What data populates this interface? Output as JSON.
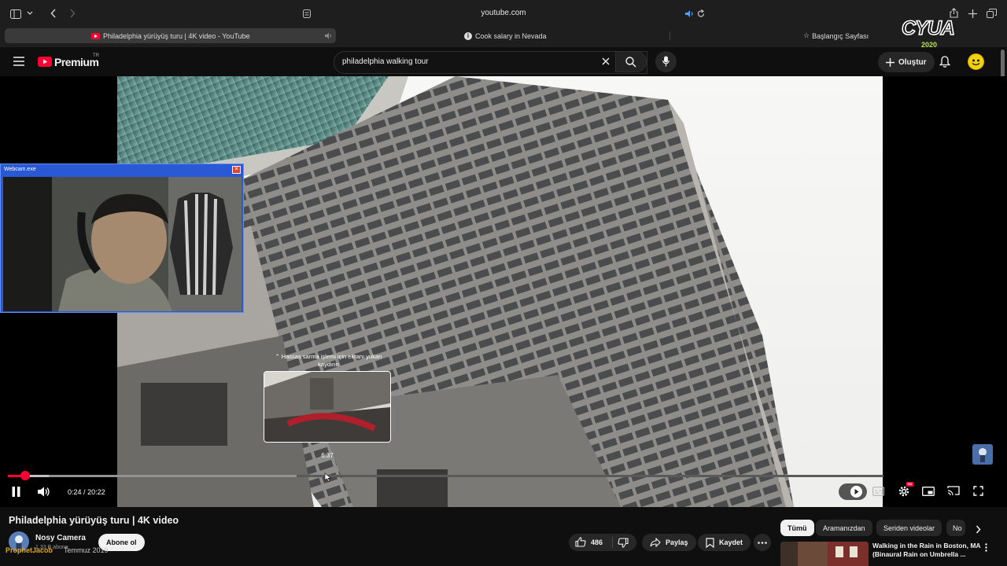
{
  "browser": {
    "url": "youtube.com",
    "tabs": [
      {
        "label": "Philadelphia yürüyüş turu | 4K video - YouTube",
        "active": true
      },
      {
        "label": "Cook salary in Nevada",
        "active": false
      },
      {
        "label": "Başlangıç Sayfası",
        "active": false
      }
    ]
  },
  "overlay_logo": {
    "text": "CYUA",
    "year": "2020"
  },
  "header": {
    "brand": "Premium",
    "region": "TR",
    "search_value": "philadelphia walking tour",
    "create_label": "Oluştur"
  },
  "webcam": {
    "title": "Webcam.exe"
  },
  "player": {
    "seek_hint": "Hassas sarma işlemi için ekranı yukarı kaydırın",
    "preview_time": "6:37",
    "current_time": "0:24",
    "duration": "20:22",
    "time_separator": "/",
    "played_fraction": 0.02,
    "buffered_fraction": 0.047,
    "hover_fraction": 0.33
  },
  "video": {
    "title": "Philadelphia yürüyüş turu | 4K video",
    "channel": "Nosy Camera",
    "subscribers": "1,33 B abone",
    "subscribe_label": "Abone ol",
    "date": "Temmuz 2019",
    "watermark": "ProphetJacob",
    "likes": "486",
    "share_label": "Paylaş",
    "save_label": "Kaydet"
  },
  "chips": [
    "Tümü",
    "Aramanızdan",
    "Seriden videolar",
    "No"
  ],
  "recommendation": {
    "title": "Walking in the Rain in Boston, MA (Binaural Rain on Umbrella ..."
  },
  "colors": {
    "accent_red": "#ff0033",
    "avatar_yellow": "#f2d20c",
    "webcam_frame": "#2a59d6"
  }
}
